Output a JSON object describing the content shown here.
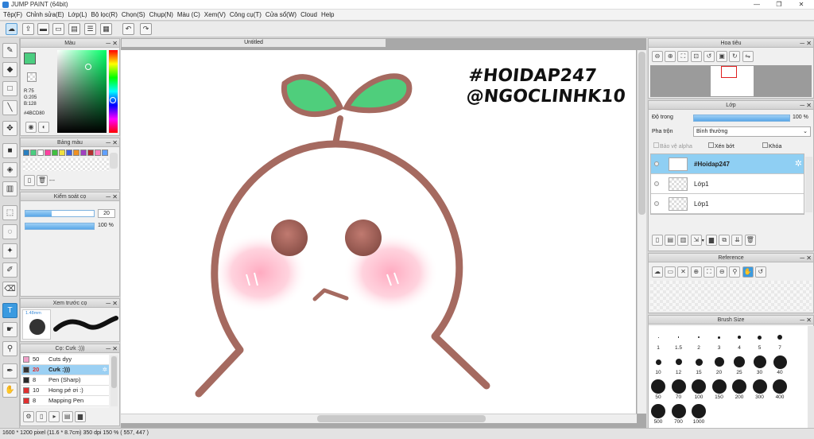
{
  "window": {
    "title": "JUMP PAINT (64bit)"
  },
  "menu": [
    "Tệp(F)",
    "Chỉnh sửa(E)",
    "Lớp(L)",
    "Bộ lọc(R)",
    "Chọn(S)",
    "Chụp(N)",
    "Màu (C)",
    "Xem(V)",
    "Công cụ(T)",
    "Cửa sổ(W)",
    "Cloud",
    "Help"
  ],
  "document": {
    "tab_title": "Untitled",
    "watermark_line1": "#HOIDAP247",
    "watermark_line2": "@NGOCLINHK10"
  },
  "color_panel": {
    "title": "Màu",
    "r": "R:75",
    "g": "G:205",
    "b": "B:128",
    "hex": "#4BCD80",
    "main_color": "#4BCD80"
  },
  "palette": {
    "title": "Bảng màu",
    "swatches": [
      "#2a7fbf",
      "#4BCD80",
      "#ffffff",
      "#ff40a0",
      "#40c040",
      "#f0e040",
      "#4060e0",
      "#f09020",
      "#a040c0",
      "#b03030",
      "#ff80c0",
      "#60a0ff"
    ],
    "more": "---"
  },
  "brush_control": {
    "title": "Kiểm soát cọ",
    "size_value": "20",
    "opacity_value": "100 %",
    "size_fraction": 0.38,
    "opacity_fraction": 1.0
  },
  "preview": {
    "title": "Xem trước cọ",
    "size_label": "1.48mm"
  },
  "brush_list": {
    "title": "Cọ: Cưk :)))",
    "items": [
      {
        "size": "50",
        "name": "Cuts dyy",
        "color": "#f0a0c8"
      },
      {
        "size": "20",
        "name": "Cưk :)))",
        "color": "#333333",
        "selected": true
      },
      {
        "size": "8",
        "name": "Pen (Sharp)",
        "color": "#2a2a2a"
      },
      {
        "size": "10",
        "name": "Hong pé ơi :)",
        "color": "#e03030"
      },
      {
        "size": "8",
        "name": "Mapping Pen",
        "color": "#e03030"
      }
    ]
  },
  "navigator": {
    "title": "Hoa tiêu"
  },
  "layer_panel": {
    "title": "Lớp",
    "opacity_label": "Độ trong",
    "opacity_value": "100 %",
    "blend_label": "Pha trộn",
    "blend_value": "Bình thường",
    "protect_alpha": "Bảo vệ alpha",
    "clipping": "Xén bớt",
    "lock": "Khóa",
    "layers": [
      {
        "name": "#Hoidap247",
        "selected": true
      },
      {
        "name": "Lớp1"
      },
      {
        "name": "Lớp1"
      }
    ]
  },
  "reference": {
    "title": "Reference"
  },
  "brush_size": {
    "title": "Brush Size",
    "sizes": [
      "1",
      "1.5",
      "2",
      "3",
      "4",
      "5",
      "7",
      "10",
      "12",
      "15",
      "20",
      "25",
      "30",
      "40",
      "50",
      "70",
      "100",
      "150",
      "200",
      "300",
      "400",
      "500",
      "700",
      "1000"
    ]
  },
  "status": {
    "dimensions": "1600 * 1200 pixel",
    "physical": "(11.6 * 8.7cm)",
    "dpi": "350 dpi",
    "zoom": "150 %",
    "cursor": "( 557, 447 )"
  },
  "colors": {
    "accent": "#3a9ae0",
    "stroke": "#a56a60",
    "leaf": "#4fce7c",
    "cheek": "#ffb8cc"
  }
}
